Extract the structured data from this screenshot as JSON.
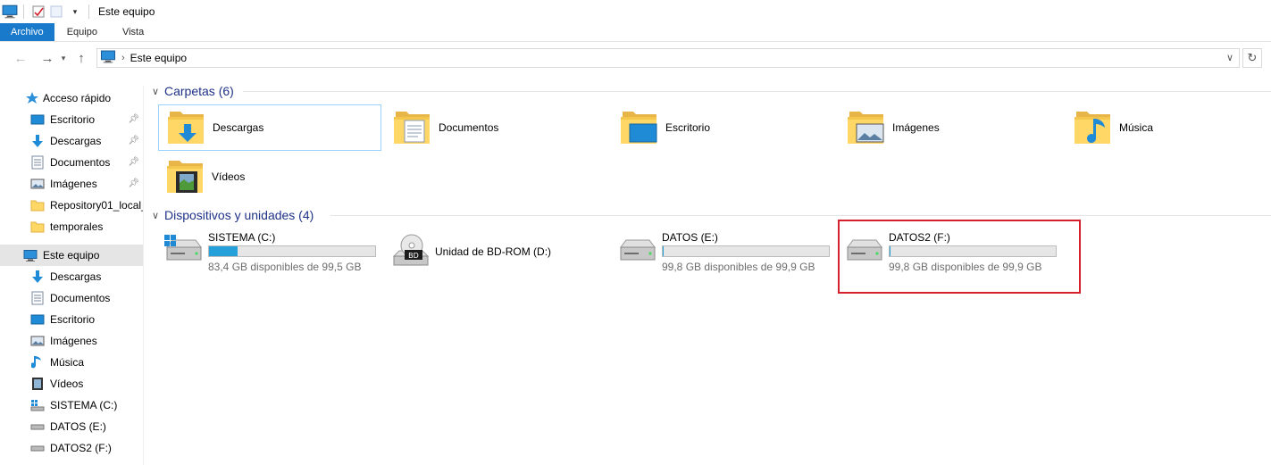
{
  "window": {
    "title": "Este equipo"
  },
  "ribbon": {
    "tabs": [
      "Archivo",
      "Equipo",
      "Vista"
    ]
  },
  "address": {
    "path": "Este equipo"
  },
  "sidebar": {
    "quick_access": "Acceso rápido",
    "quick_items": [
      {
        "label": "Escritorio",
        "icon": "desktop-icon",
        "pinned": true
      },
      {
        "label": "Descargas",
        "icon": "download-icon",
        "pinned": true
      },
      {
        "label": "Documentos",
        "icon": "document-icon",
        "pinned": true
      },
      {
        "label": "Imágenes",
        "icon": "pictures-icon",
        "pinned": true
      },
      {
        "label": "Repository01_local_",
        "icon": "folder-icon",
        "pinned": false
      },
      {
        "label": "temporales",
        "icon": "folder-icon",
        "pinned": false
      }
    ],
    "this_pc": "Este equipo",
    "pc_items": [
      {
        "label": "Descargas",
        "icon": "download-icon"
      },
      {
        "label": "Documentos",
        "icon": "document-icon"
      },
      {
        "label": "Escritorio",
        "icon": "desktop-icon"
      },
      {
        "label": "Imágenes",
        "icon": "pictures-icon"
      },
      {
        "label": "Música",
        "icon": "music-icon"
      },
      {
        "label": "Vídeos",
        "icon": "video-icon"
      },
      {
        "label": "SISTEMA (C:)",
        "icon": "system-drive-icon"
      },
      {
        "label": "DATOS (E:)",
        "icon": "drive-icon"
      },
      {
        "label": "DATOS2 (F:)",
        "icon": "drive-icon"
      }
    ]
  },
  "folders": {
    "header": "Carpetas (6)",
    "items": [
      {
        "label": "Descargas",
        "icon": "downloads-folder-icon"
      },
      {
        "label": "Documentos",
        "icon": "documents-folder-icon"
      },
      {
        "label": "Escritorio",
        "icon": "desktop-folder-icon"
      },
      {
        "label": "Imágenes",
        "icon": "pictures-folder-icon"
      },
      {
        "label": "Música",
        "icon": "music-folder-icon"
      },
      {
        "label": "Vídeos",
        "icon": "videos-folder-icon"
      }
    ]
  },
  "devices": {
    "header": "Dispositivos y unidades (4)",
    "items": [
      {
        "name": "SISTEMA (C:)",
        "free": "83,4 GB disponibles de 99,5 GB",
        "used_fraction": 0.17,
        "icon": "system-drive-icon"
      },
      {
        "name": "Unidad de BD-ROM (D:)",
        "free": "",
        "used_fraction": null,
        "icon": "bd-rom-icon",
        "badge": "BD"
      },
      {
        "name": "DATOS (E:)",
        "free": "99,8 GB disponibles de 99,9 GB",
        "used_fraction": 0.001,
        "icon": "drive-icon"
      },
      {
        "name": "DATOS2 (F:)",
        "free": "99,8 GB disponibles de 99,9 GB",
        "used_fraction": 0.001,
        "icon": "drive-icon"
      }
    ]
  },
  "colors": {
    "accent": "#1979ca",
    "bar_fill": "#26a0da",
    "header_text": "#1e3287",
    "highlight": "#d6202e"
  }
}
